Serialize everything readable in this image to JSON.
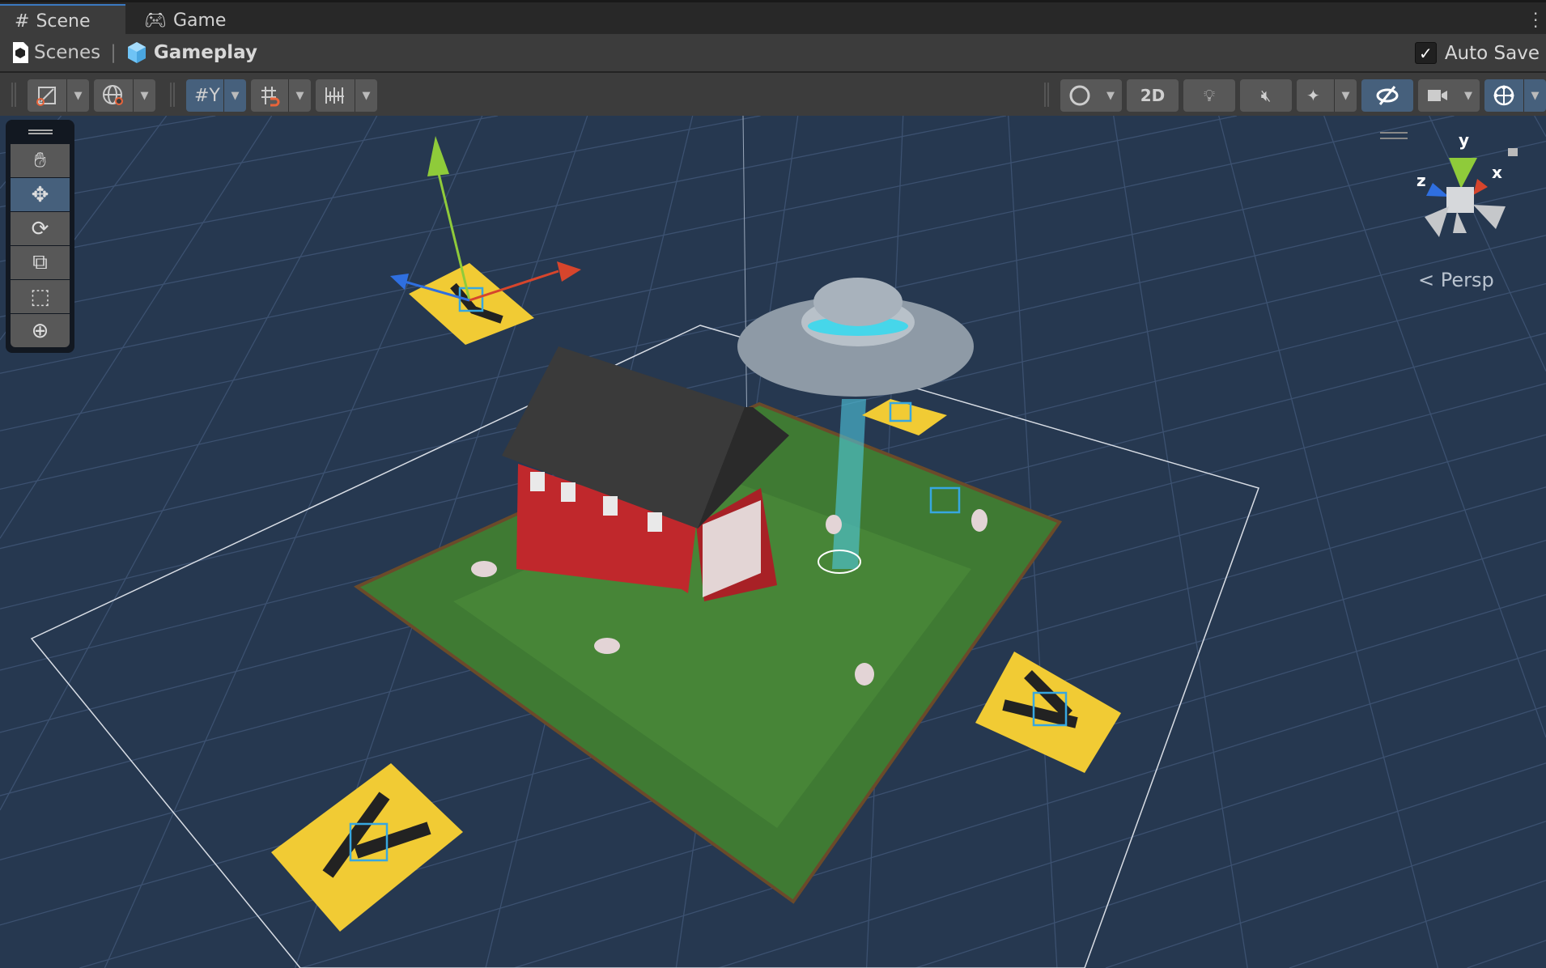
{
  "tabs": [
    {
      "label": "Scene",
      "icon": "grid-hash-icon",
      "active": true
    },
    {
      "label": "Game",
      "icon": "gamepad-icon",
      "active": false
    }
  ],
  "breadcrumb": {
    "root": "Scenes",
    "current": "Gameplay"
  },
  "auto_save": {
    "label": "Auto Save",
    "checked": true
  },
  "toolbar": {
    "two_d_label": "2D"
  },
  "tools": [
    "hand-tool",
    "move-tool",
    "rotate-tool",
    "scale-tool",
    "rect-tool",
    "transform-tool"
  ],
  "active_tool": "move-tool",
  "gizmo": {
    "x": "x",
    "y": "y",
    "z": "z",
    "projection": "Persp"
  },
  "colors": {
    "accent": "#46607c",
    "x_axis": "#d6452c",
    "y_axis": "#8fcb3a",
    "z_axis": "#2f6fe0",
    "sky": "#263850"
  }
}
